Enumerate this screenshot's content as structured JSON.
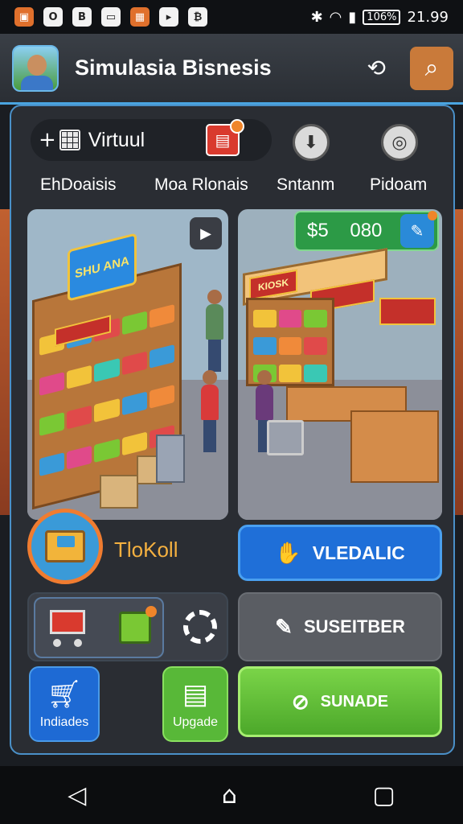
{
  "status_bar": {
    "time": "21.99",
    "battery": "106%",
    "notification_icons": [
      "wallet-app-icon",
      "o-app-icon",
      "b-app-icon",
      "image-app-icon",
      "shop-app-icon",
      "docs-app-icon",
      "bitcoin-app-icon"
    ],
    "system_icons": [
      "bluetooth-icon",
      "wifi-icon",
      "signal-icon"
    ]
  },
  "app_bar": {
    "title": "Simulasia Bisnesis",
    "share_icon": "share-icon",
    "search_icon": "search-icon",
    "accent_color": "#4aa4e0"
  },
  "top_tabs": {
    "virtual_label": "Virtuul",
    "items": [
      {
        "label": "EhDoaisis"
      },
      {
        "label": "Moa Rlonais"
      },
      {
        "label": "Sntanm"
      },
      {
        "label": "Pidoam"
      }
    ]
  },
  "store_scene_left": {
    "sign_text": "SHU ANA",
    "play_icon": "play-icon"
  },
  "store_scene_right": {
    "money_amount": "$5 080",
    "kiosk_sign": "KIOSK",
    "edit_icon": "edit-icon"
  },
  "tokoll": {
    "label": "TloKoll"
  },
  "buttons": {
    "blue": {
      "label": "VLEDALIC",
      "icon": "hand-icon"
    },
    "gray": {
      "label": "SUSEITBER",
      "icon": "tag-icon"
    },
    "green": {
      "label": "SUNADE",
      "icon": "no-phone-icon"
    },
    "indi": {
      "label": "Indiades",
      "icon": "cart-icon"
    },
    "upgrade": {
      "label": "Upgade",
      "icon": "notepad-icon"
    }
  },
  "navbar": {
    "back": "◁",
    "home": "⌂",
    "recent": "▢"
  }
}
